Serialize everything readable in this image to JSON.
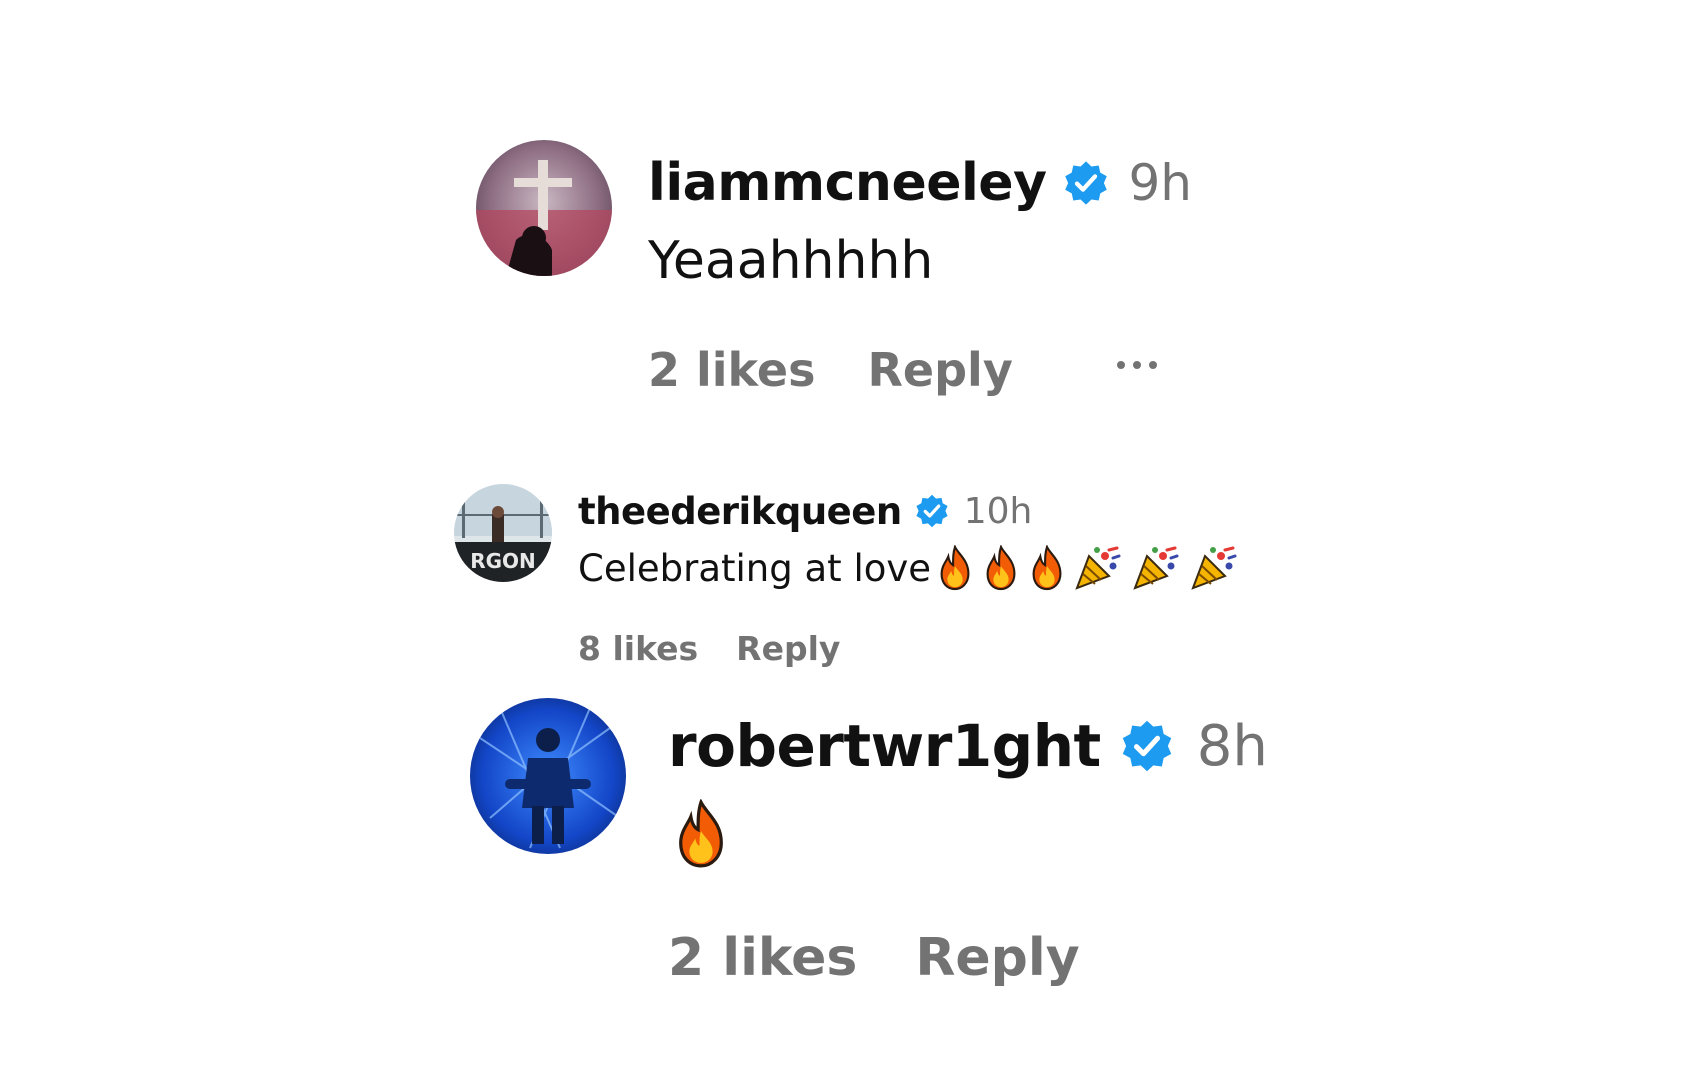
{
  "colors": {
    "verified": "#1D9BF0",
    "secondary_text": "#737373",
    "primary_text": "#111111"
  },
  "comments": [
    {
      "username": "liammcneeley",
      "verified": true,
      "time": "9h",
      "text": "Yeaahhhhh",
      "likes": "2 likes",
      "reply": "Reply",
      "more_icon": "more-horizontal-icon"
    },
    {
      "username": "theederikqueen",
      "verified": true,
      "time": "10h",
      "text": "Celebrating at love",
      "emojis": [
        "fire-icon",
        "fire-icon",
        "fire-icon",
        "party-popper-icon",
        "party-popper-icon",
        "party-popper-icon"
      ],
      "likes": "8 likes",
      "reply": "Reply"
    },
    {
      "username": "robertwr1ght",
      "verified": true,
      "time": "8h",
      "text": "",
      "emojis": [
        "fire-icon"
      ],
      "likes": "2 likes",
      "reply": "Reply"
    }
  ]
}
